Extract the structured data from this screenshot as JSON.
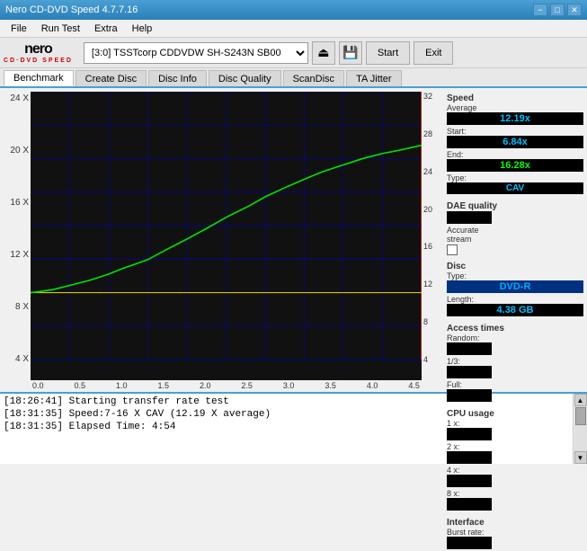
{
  "app": {
    "title": "Nero CD-DVD Speed 4.7.7.16",
    "version": "4.7.7.16"
  },
  "titlebar": {
    "title": "Nero CD-DVD Speed 4.7.7.16",
    "minimize": "−",
    "maximize": "□",
    "close": "✕"
  },
  "menu": {
    "items": [
      "File",
      "Run Test",
      "Extra",
      "Help"
    ]
  },
  "toolbar": {
    "drive_value": "[3:0]  TSSTcorp CDDVDW SH-S243N SB00",
    "start_label": "Start",
    "exit_label": "Exit"
  },
  "tabs": [
    {
      "id": "benchmark",
      "label": "Benchmark"
    },
    {
      "id": "create-disc",
      "label": "Create Disc"
    },
    {
      "id": "disc-info",
      "label": "Disc Info"
    },
    {
      "id": "disc-quality",
      "label": "Disc Quality"
    },
    {
      "id": "scandisc",
      "label": "ScanDisc"
    },
    {
      "id": "ta-jitter",
      "label": "TA Jitter"
    }
  ],
  "active_tab": "benchmark",
  "stats": {
    "speed": {
      "title": "Speed",
      "average_label": "Average",
      "average_value": "12.19x",
      "start_label": "Start:",
      "start_value": "6.84x",
      "end_label": "End:",
      "end_value": "16.28x",
      "type_label": "Type:",
      "type_value": "CAV"
    },
    "dae": {
      "title": "DAE quality",
      "value": "",
      "accurate_stream_label": "Accurate",
      "accurate_stream_sub": "stream",
      "checked": false
    },
    "disc": {
      "title": "Disc",
      "type_label": "Type:",
      "type_value": "DVD-R",
      "length_label": "Length:",
      "length_value": "4.38 GB"
    },
    "access_times": {
      "title": "Access times",
      "random_label": "Random:",
      "one_third_label": "1/3:",
      "full_label": "Full:"
    },
    "cpu": {
      "title": "CPU usage",
      "x1_label": "1 x:",
      "x2_label": "2 x:",
      "x4_label": "4 x:",
      "x8_label": "8 x:"
    },
    "interface": {
      "title": "Interface",
      "burst_label": "Burst rate:"
    }
  },
  "chart": {
    "y_labels_left": [
      "24 X",
      "20 X",
      "16 X",
      "12 X",
      "8 X",
      "4 X"
    ],
    "y_labels_right": [
      "32",
      "28",
      "24",
      "20",
      "16",
      "12",
      "8",
      "4"
    ],
    "x_labels": [
      "0.0",
      "0.5",
      "1.0",
      "1.5",
      "2.0",
      "2.5",
      "3.0",
      "3.5",
      "4.0",
      "4.5"
    ],
    "colors": {
      "grid": "#0000aa",
      "curve": "#00cc00",
      "horizontal_line": "#ffff00",
      "vertical_line": "#ff0000"
    }
  },
  "log": {
    "entries": [
      "[18:26:41]  Starting transfer rate test",
      "[18:31:35]  Speed:7-16 X CAV (12.19 X average)",
      "[18:31:35]  Elapsed Time: 4:54"
    ]
  }
}
